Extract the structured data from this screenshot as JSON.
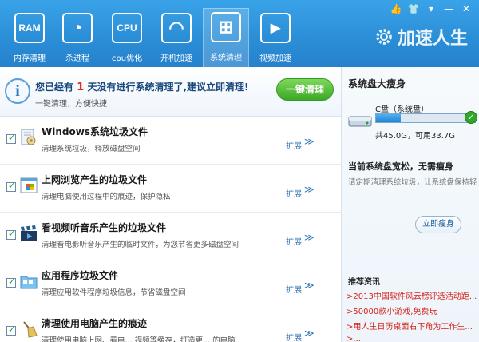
{
  "window_controls": {
    "like": "👍",
    "skin": "👕",
    "menu": "▾",
    "minimize": "—",
    "close": "✕"
  },
  "tools": [
    {
      "icon_text": "RAM",
      "label": "内存清理"
    },
    {
      "icon_text": "◔",
      "label": "杀进程"
    },
    {
      "icon_text": "CPU",
      "label": "cpu优化"
    },
    {
      "icon_text": "◠",
      "label": "开机加速"
    },
    {
      "icon_text": "⊞",
      "label": "系统清理"
    },
    {
      "icon_text": "▶",
      "label": "视频加速"
    }
  ],
  "brand": {
    "name": "加速人生"
  },
  "banner": {
    "title_prefix": "您已经有",
    "days": "1",
    "title_suffix": "天没有进行系统清理了,建议立即清理!",
    "subtitle": "一键清理，方便快捷",
    "button": "一键清理"
  },
  "items": [
    {
      "title": "Windows系统垃圾文件",
      "desc": "清理系统垃圾，释放磁盘空间",
      "expand": "扩展",
      "icon": "gear-document-icon"
    },
    {
      "title": "上网浏览产生的垃圾文件",
      "desc": "清理电脑使用过程中的痕迹，保护隐私",
      "expand": "扩展",
      "icon": "browser-icon"
    },
    {
      "title": "看视频听音乐产生的垃圾文件",
      "desc": "清理看电影听音乐产生的临时文件，为您节省更多磁盘空间",
      "expand": "扩展",
      "icon": "clapperboard-icon"
    },
    {
      "title": "应用程序垃圾文件",
      "desc": "清理应用软件程序垃圾信息，节省磁盘空间",
      "expand": "扩展",
      "icon": "folder-icon"
    },
    {
      "title": "清理使用电脑产生的痕迹",
      "desc": "清理使用电脑上网、看电... 视频等缓存，打造更... 的电脑",
      "expand": "扩展",
      "icon": "broom-icon"
    }
  ],
  "side": {
    "heading": "系统盘大瘦身",
    "drive_label": "C盘（系统盘）",
    "usage_fraction": 0.25,
    "capacity": "共45.0G，可用33.7G",
    "advice_title": "当前系统盘宽松，无需瘦身",
    "advice_sub": "请定期清理系统垃圾，让系统盘保持轻",
    "button": "立即瘦身",
    "news_heading": "推荐资讯",
    "news": [
      ">2013中国软件风云榜评选活动距...",
      ">50000款小游戏,免费玩",
      ">用人生日历桌面右下角为工作生...",
      ">..."
    ]
  },
  "colors": {
    "toolbar": "#2b8fd8",
    "accent_green": "#3aa925",
    "alert_red": "#e12b1e",
    "link_blue": "#2d6fb3"
  }
}
